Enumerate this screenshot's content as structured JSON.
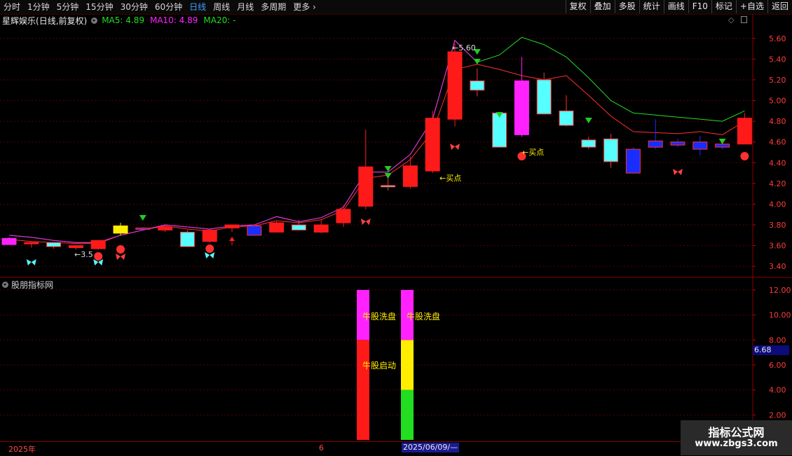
{
  "toolbar": {
    "left_items": [
      "分时",
      "1分钟",
      "5分钟",
      "15分钟",
      "30分钟",
      "60分钟",
      "日线",
      "周线",
      "月线",
      "多周期",
      "更多"
    ],
    "active": "日线",
    "right_items": [
      "复权",
      "叠加",
      "多股",
      "统计",
      "画线",
      "F10",
      "标记",
      "+自选",
      "返回"
    ]
  },
  "header": {
    "stock_name": "星辉娱乐",
    "mode": "(日线,前复权)",
    "ma5": "MA5: 4.89",
    "ma10": "MA10: 4.89",
    "ma20": "MA20: -",
    "colors": {
      "ma5": "#22dd22",
      "ma10": "#ff22ff",
      "ma20": "#22dd22"
    }
  },
  "price_axis": [
    "5.60",
    "5.40",
    "5.20",
    "5.00",
    "4.80",
    "4.60",
    "4.40",
    "4.20",
    "4.00",
    "3.80",
    "3.60",
    "3.40"
  ],
  "annotations": {
    "high_label": "←5.60",
    "low_label": "←3.5",
    "buy_label_1": "←买点",
    "buy_label_2": "←买点"
  },
  "sub_panel": {
    "title": "股朋指标网",
    "axis": [
      "12.00",
      "10.00",
      "8.00",
      "6.00",
      "4.00",
      "2.00"
    ],
    "current_value": "6.68",
    "bar1_top_text": "牛股洗盘",
    "bar1_bottom_text": "牛股启动",
    "bar2_top_text": "牛股洗盘"
  },
  "date_bar": {
    "year": "2025年",
    "month": "6",
    "selected": "2025/06/09/—"
  },
  "watermark": {
    "line1": "指标公式网",
    "line2": "www.zbgs3.com"
  },
  "chart_data": {
    "type": "candlestick",
    "ylim": [
      3.3,
      5.7
    ],
    "candles": [
      {
        "o": 3.67,
        "h": 3.68,
        "l": 3.61,
        "c": 3.61,
        "color": "magenta"
      },
      {
        "o": 3.62,
        "h": 3.64,
        "l": 3.58,
        "c": 3.63,
        "color": "red"
      },
      {
        "o": 3.59,
        "h": 3.63,
        "l": 3.57,
        "c": 3.63,
        "color": "cyan"
      },
      {
        "o": 3.58,
        "h": 3.6,
        "l": 3.56,
        "c": 3.6,
        "color": "red"
      },
      {
        "o": 3.57,
        "h": 3.65,
        "l": 3.56,
        "c": 3.65,
        "color": "red"
      },
      {
        "o": 3.72,
        "h": 3.82,
        "l": 3.7,
        "c": 3.79,
        "color": "yellow"
      },
      {
        "o": 3.77,
        "h": 3.78,
        "l": 3.74,
        "c": 3.76,
        "color": "blue"
      },
      {
        "o": 3.75,
        "h": 3.79,
        "l": 3.73,
        "c": 3.78,
        "color": "red"
      },
      {
        "o": 3.73,
        "h": 3.75,
        "l": 3.59,
        "c": 3.59,
        "color": "cyan"
      },
      {
        "o": 3.64,
        "h": 3.76,
        "l": 3.63,
        "c": 3.75,
        "color": "red"
      },
      {
        "o": 3.77,
        "h": 3.8,
        "l": 3.73,
        "c": 3.8,
        "color": "red"
      },
      {
        "o": 3.79,
        "h": 3.79,
        "l": 3.7,
        "c": 3.7,
        "color": "blue"
      },
      {
        "o": 3.73,
        "h": 3.84,
        "l": 3.73,
        "c": 3.82,
        "color": "red"
      },
      {
        "o": 3.8,
        "h": 3.85,
        "l": 3.75,
        "c": 3.75,
        "color": "cyan"
      },
      {
        "o": 3.73,
        "h": 3.85,
        "l": 3.72,
        "c": 3.8,
        "color": "red"
      },
      {
        "o": 3.82,
        "h": 3.99,
        "l": 3.78,
        "c": 3.95,
        "color": "red"
      },
      {
        "o": 3.98,
        "h": 4.72,
        "l": 3.95,
        "c": 4.36,
        "color": "red"
      },
      {
        "o": 4.18,
        "h": 4.25,
        "l": 4.13,
        "c": 4.18,
        "color": "cyan"
      },
      {
        "o": 4.17,
        "h": 4.46,
        "l": 4.15,
        "c": 4.37,
        "color": "red"
      },
      {
        "o": 4.32,
        "h": 4.9,
        "l": 4.3,
        "c": 4.83,
        "color": "red"
      },
      {
        "o": 4.82,
        "h": 5.55,
        "l": 4.75,
        "c": 5.47,
        "color": "red"
      },
      {
        "o": 5.19,
        "h": 5.31,
        "l": 5.04,
        "c": 5.1,
        "color": "cyan"
      },
      {
        "o": 4.88,
        "h": 4.89,
        "l": 4.55,
        "c": 4.55,
        "color": "cyan"
      },
      {
        "o": 4.67,
        "h": 5.42,
        "l": 4.65,
        "c": 5.19,
        "color": "magenta"
      },
      {
        "o": 5.2,
        "h": 5.27,
        "l": 4.87,
        "c": 4.87,
        "color": "cyan"
      },
      {
        "o": 4.9,
        "h": 5.05,
        "l": 4.75,
        "c": 4.76,
        "color": "cyan"
      },
      {
        "o": 4.62,
        "h": 4.65,
        "l": 4.53,
        "c": 4.55,
        "color": "cyan"
      },
      {
        "o": 4.63,
        "h": 4.68,
        "l": 4.35,
        "c": 4.41,
        "color": "cyan"
      },
      {
        "o": 4.53,
        "h": 4.55,
        "l": 4.3,
        "c": 4.3,
        "color": "blue"
      },
      {
        "o": 4.55,
        "h": 4.82,
        "l": 4.53,
        "c": 4.61,
        "color": "blue"
      },
      {
        "o": 4.6,
        "h": 4.63,
        "l": 4.55,
        "c": 4.57,
        "color": "blue"
      },
      {
        "o": 4.6,
        "h": 4.66,
        "l": 4.47,
        "c": 4.53,
        "color": "blue"
      },
      {
        "o": 4.58,
        "h": 4.6,
        "l": 4.53,
        "c": 4.55,
        "color": "blue"
      },
      {
        "o": 4.58,
        "h": 4.88,
        "l": 4.58,
        "c": 4.83,
        "color": "red"
      }
    ],
    "ma_green": [
      3.7,
      3.68,
      3.65,
      3.63,
      3.63,
      3.7,
      3.75,
      3.8,
      3.78,
      3.76,
      3.79,
      3.8,
      3.88,
      3.83,
      3.87,
      3.97,
      4.31,
      4.31,
      4.48,
      4.82,
      5.58,
      5.37,
      5.44,
      5.61,
      5.54,
      5.42,
      5.22,
      5.0,
      4.88,
      4.86,
      4.84,
      4.82,
      4.8,
      4.9
    ],
    "ma_red": [
      3.66,
      3.64,
      3.63,
      3.62,
      3.62,
      3.7,
      3.75,
      3.79,
      3.76,
      3.74,
      3.78,
      3.79,
      3.84,
      3.82,
      3.85,
      3.94,
      4.25,
      4.28,
      4.43,
      4.7,
      5.3,
      5.35,
      5.3,
      5.24,
      5.2,
      5.24,
      5.05,
      4.85,
      4.7,
      4.69,
      4.68,
      4.7,
      4.67,
      4.8
    ],
    "ma_magenta_last_index": 21,
    "sub_bars": [
      {
        "index": 16,
        "segments": [
          {
            "from": 0,
            "to": 8,
            "color": "red"
          },
          {
            "from": 8,
            "to": 12,
            "color": "magenta"
          }
        ]
      },
      {
        "index": 18,
        "segments": [
          {
            "from": 0,
            "to": 4,
            "color": "green"
          },
          {
            "from": 4,
            "to": 8,
            "color": "yellow"
          },
          {
            "from": 8,
            "to": 12,
            "color": "magenta"
          }
        ]
      }
    ],
    "sub_ylim": [
      0,
      12.5
    ]
  }
}
